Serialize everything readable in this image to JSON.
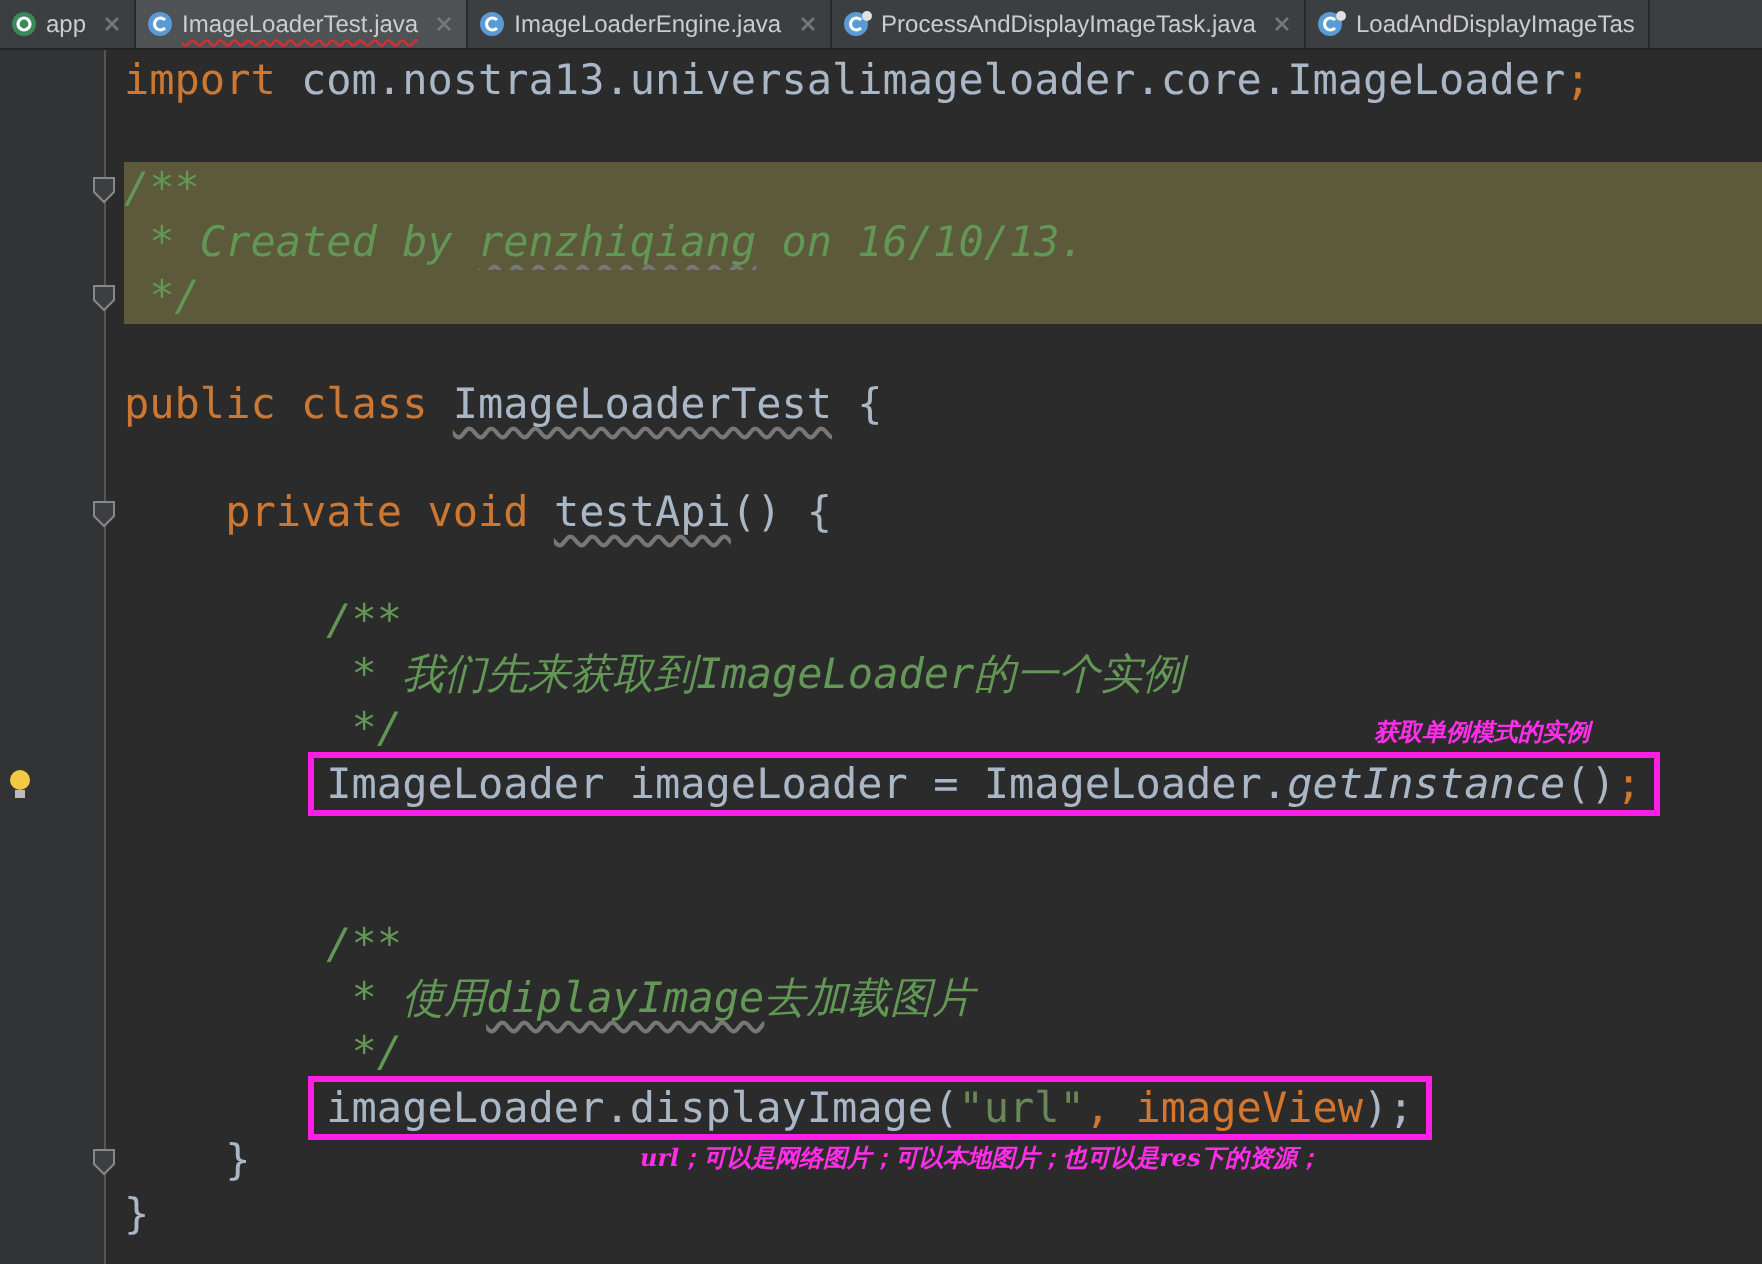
{
  "tabs": [
    {
      "label": "app",
      "kind": "module",
      "selected": false,
      "closable": true
    },
    {
      "label": "ImageLoaderTest.java",
      "kind": "class",
      "selected": true,
      "closable": true
    },
    {
      "label": "ImageLoaderEngine.java",
      "kind": "class",
      "selected": false,
      "closable": true
    },
    {
      "label": "ProcessAndDisplayImageTask.java",
      "kind": "task",
      "selected": false,
      "closable": true
    },
    {
      "label": "LoadAndDisplayImageTas",
      "kind": "task",
      "selected": false,
      "closable": false
    }
  ],
  "lines": [
    {
      "kind": "code",
      "tokens": [
        {
          "text": "import",
          "kind": "keyword"
        },
        {
          "text": " com.nostra13.universalimageloader.core.",
          "kind": "plain"
        },
        {
          "text": "ImageLoader",
          "kind": "plain"
        },
        {
          "text": ";",
          "kind": "keyword"
        }
      ]
    },
    {
      "kind": "blank"
    },
    {
      "kind": "code",
      "highlight": true,
      "foldable": true,
      "tokens": [
        {
          "text": "/**",
          "kind": "comment"
        }
      ]
    },
    {
      "kind": "code",
      "highlight": true,
      "tokens": [
        {
          "text": " * Created by ",
          "kind": "comment"
        },
        {
          "text": "renzhiqiang",
          "kind": "comment-typo"
        },
        {
          "text": " on 16/10/13.",
          "kind": "comment"
        }
      ]
    },
    {
      "kind": "code",
      "highlight": true,
      "foldable": true,
      "tokens": [
        {
          "text": " */",
          "kind": "comment"
        }
      ]
    },
    {
      "kind": "blank"
    },
    {
      "kind": "code",
      "tokens": [
        {
          "text": "public class ",
          "kind": "keyword"
        },
        {
          "text": "ImageLoaderTest",
          "kind": "plain-typo"
        },
        {
          "text": " {",
          "kind": "plain"
        }
      ],
      "children": [
        {
          "kind": "blank"
        },
        {
          "kind": "code",
          "foldable": true,
          "tokens": [
            {
              "text": "private void ",
              "kind": "keyword"
            },
            {
              "text": "testApi",
              "kind": "plain-typo"
            },
            {
              "text": "() {",
              "kind": "plain"
            }
          ],
          "children": [
            {
              "kind": "blank"
            },
            {
              "kind": "code",
              "tokens": [
                {
                  "text": "/**",
                  "kind": "comment"
                }
              ]
            },
            {
              "kind": "code",
              "tokens": [
                {
                  "text": " * 我们先来获取到ImageLoader的一个实例",
                  "kind": "comment"
                }
              ]
            },
            {
              "kind": "code",
              "tokens": [
                {
                  "text": " */",
                  "kind": "comment"
                }
              ]
            },
            {
              "kind": "code",
              "lightbulb": true,
              "boxed": true,
              "note_above": "获取单例模式的实例",
              "tokens": [
                {
                  "text": "ImageLoader imageLoader = ImageLoader.",
                  "kind": "plain"
                },
                {
                  "text": "getInstance",
                  "kind": "method"
                },
                {
                  "text": "()",
                  "kind": "plain"
                },
                {
                  "text": ";",
                  "kind": "keyword"
                }
              ]
            },
            {
              "kind": "blank"
            },
            {
              "kind": "blank"
            },
            {
              "kind": "code",
              "tokens": [
                {
                  "text": "/**",
                  "kind": "comment"
                }
              ]
            },
            {
              "kind": "code",
              "tokens": [
                {
                  "text": " * 使用",
                  "kind": "comment"
                },
                {
                  "text": "diplayImage",
                  "kind": "comment-typo"
                },
                {
                  "text": "去加载图片",
                  "kind": "comment"
                }
              ]
            },
            {
              "kind": "code",
              "tokens": [
                {
                  "text": " */",
                  "kind": "comment"
                }
              ]
            },
            {
              "kind": "code",
              "boxed": true,
              "note_below": "url；可以是网络图片；可以本地图片；也可以是res下的资源；",
              "tokens": [
                {
                  "text": "imageLoader.displayImage(",
                  "kind": "plain"
                },
                {
                  "text": "\"url\"",
                  "kind": "string"
                },
                {
                  "text": ", ",
                  "kind": "keyword"
                },
                {
                  "text": "imageView",
                  "kind": "param"
                },
                {
                  "text": ");",
                  "kind": "plain"
                }
              ]
            }
          ]
        },
        {
          "kind": "code",
          "foldable": true,
          "tokens": [
            {
              "text": "}",
              "kind": "plain"
            }
          ]
        }
      ]
    },
    {
      "kind": "code",
      "tokens": [
        {
          "text": "}",
          "kind": "plain"
        }
      ]
    }
  ]
}
